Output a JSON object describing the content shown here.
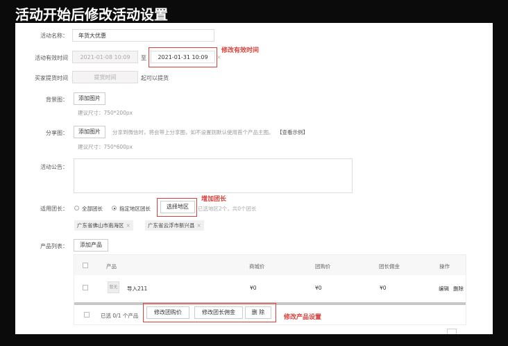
{
  "page_title": "活动开始后修改活动设置",
  "form": {
    "name": {
      "label": "活动名称：",
      "value": "年货大优惠"
    },
    "valid_time": {
      "label": "活动有效时间",
      "start": "2021-01-08 10:09",
      "separator": "至",
      "end": "2021-01-31 10:09",
      "clear": "×"
    },
    "pickup": {
      "label": "买家提货时间",
      "placeholder": "提货时间",
      "suffix": "起可以提货"
    },
    "background": {
      "label": "背景图：",
      "button": "添加图片",
      "hint": "建议尺寸：750*200px"
    },
    "share": {
      "label": "分享图：",
      "button": "添加图片",
      "desc": "分享到微信时，将会带上分享图，如不设置则默认使用首个产品主图。",
      "example_link": "【查看示例】",
      "hint": "建议尺寸：750*600px"
    },
    "notice": {
      "label": "活动公告："
    },
    "leaders": {
      "label": "适用团长：",
      "option_all": "全部团长",
      "option_region": "指定地区团长",
      "select_button": "选择地区",
      "summary": "已选地区2个，共0个团长",
      "regions": [
        "广东省佛山市南海区",
        "广东省云浮市新兴县"
      ]
    },
    "products": {
      "label": "产品列表：",
      "add_button": "添加产品",
      "columns": [
        "产品",
        "商城价",
        "团购价",
        "团长佣金",
        "操作"
      ],
      "rows": [
        {
          "thumb_text": "暂无",
          "name": "导入211",
          "mall_price": "¥0",
          "group_price": "¥0",
          "commission": "¥0",
          "edit": "编辑",
          "delete": "删除"
        }
      ],
      "footer": {
        "selected_prefix": "已选",
        "selected_count": "0",
        "selected_suffix": "/1 个产品",
        "btn_group_price": "修改团购价",
        "btn_commission": "修改团长佣金",
        "btn_delete": "删 除"
      }
    }
  },
  "annotations": {
    "valid_time": "修改有效时间",
    "leaders": "增加团长",
    "products": "修改产品设置"
  },
  "colors": {
    "accent_red": "#d9413b",
    "brand_red": "#c0392b"
  }
}
